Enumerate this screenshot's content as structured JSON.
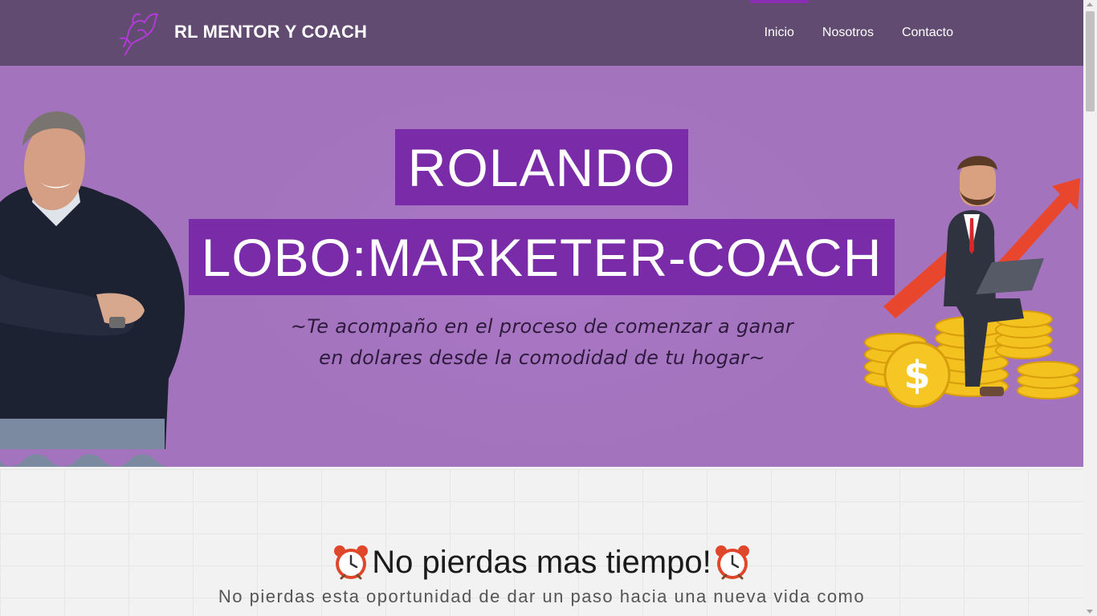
{
  "header": {
    "brand_name": "RL MENTOR Y COACH",
    "logo_icon": "wolf-logo-icon",
    "nav": [
      {
        "label": "Inicio",
        "active": true
      },
      {
        "label": "Nosotros",
        "active": false
      },
      {
        "label": "Contacto",
        "active": false
      }
    ]
  },
  "hero": {
    "title_line1": "ROLANDO",
    "title_line2": "LOBO:MARKETER-COACH",
    "subtitle_line1": "~Te acompaño en el proceso de comenzar a ganar",
    "subtitle_line2": "en dolares desde la comodidad de tu hogar~"
  },
  "section": {
    "icon": "alarm-clock-icon",
    "title": "No pierdas mas tiempo!",
    "text": "No pierdas esta oportunidad de dar un paso hacia una nueva vida como"
  },
  "colors": {
    "header_bg": "#624b70",
    "hero_bg": "#a374bd",
    "title_box_bg": "#7a2ca8",
    "accent": "#8a2fb3"
  }
}
